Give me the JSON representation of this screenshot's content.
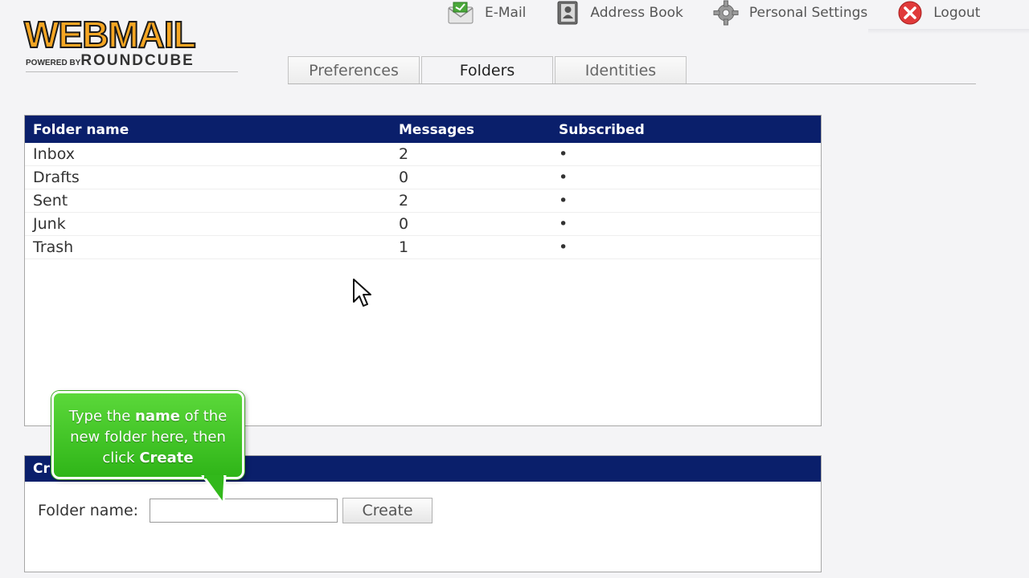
{
  "logo": {
    "main": "WEBMAIL",
    "powered_by": "POWERED BY",
    "brand": "ROUNDCUBE"
  },
  "topnav": [
    {
      "label": "E-Mail",
      "icon": "mail-icon"
    },
    {
      "label": "Address Book",
      "icon": "address-book-icon"
    },
    {
      "label": "Personal Settings",
      "icon": "gear-icon"
    },
    {
      "label": "Logout",
      "icon": "close-icon"
    }
  ],
  "tabs": [
    {
      "label": "Preferences",
      "active": false
    },
    {
      "label": "Folders",
      "active": true
    },
    {
      "label": "Identities",
      "active": false
    }
  ],
  "folder_table": {
    "headers": {
      "name": "Folder name",
      "messages": "Messages",
      "subscribed": "Subscribed"
    },
    "rows": [
      {
        "name": "Inbox",
        "messages": "2",
        "subscribed": "•"
      },
      {
        "name": "Drafts",
        "messages": "0",
        "subscribed": "•"
      },
      {
        "name": "Sent",
        "messages": "2",
        "subscribed": "•"
      },
      {
        "name": "Junk",
        "messages": "0",
        "subscribed": "•"
      },
      {
        "name": "Trash",
        "messages": "1",
        "subscribed": "•"
      }
    ]
  },
  "create_panel": {
    "header_visible": "Cr",
    "label": "Folder name:",
    "input_value": "",
    "button": "Create"
  },
  "callout": {
    "part1": "Type the ",
    "bold1": "name",
    "part2": " of the new folder here, then click ",
    "bold2": "Create"
  },
  "colors": {
    "header_navy": "#0a1f6b",
    "logo_orange": "#f5a623",
    "callout_green": "#3ec424",
    "logout_red": "#e03a3a"
  }
}
